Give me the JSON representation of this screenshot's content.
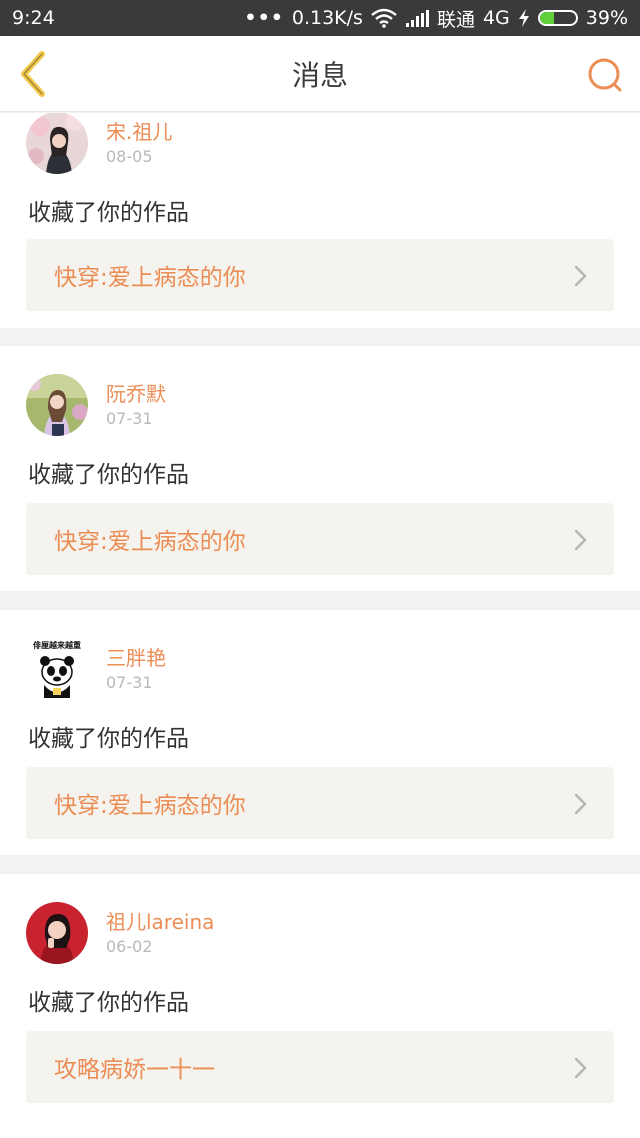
{
  "status_bar": {
    "time": "9:24",
    "dots": "•••",
    "speed": "0.13K/s",
    "carrier": "联通",
    "network": "4G",
    "battery": "39%",
    "battery_level": 0.39
  },
  "nav": {
    "title": "消息",
    "back_icon": "chevron-left-icon",
    "search_icon": "search-icon"
  },
  "colors": {
    "accent": "#ec8d55",
    "back_arrow": "#f2c94c",
    "text": "#333333",
    "muted": "#b9b9b9",
    "work_box": "#f4f3ee"
  },
  "messages": [
    {
      "user": "宋.祖儿",
      "date": "08-05",
      "action": "收藏了你的作品",
      "work": "快穿:爱上病态的你",
      "avatar": "avatar-photo"
    },
    {
      "user": "阮乔默",
      "date": "07-31",
      "action": "收藏了你的作品",
      "work": "快穿:爱上病态的你",
      "avatar": "avatar-photo"
    },
    {
      "user": "三胖艳",
      "date": "07-31",
      "action": "收藏了你的作品",
      "work": "快穿:爱上病态的你",
      "avatar": "panda-meme-avatar",
      "avatar_caption": "俳厘越来越重"
    },
    {
      "user": "祖儿lareina",
      "date": "06-02",
      "action": "收藏了你的作品",
      "work": "攻略病娇一十一",
      "avatar": "avatar-photo"
    }
  ]
}
